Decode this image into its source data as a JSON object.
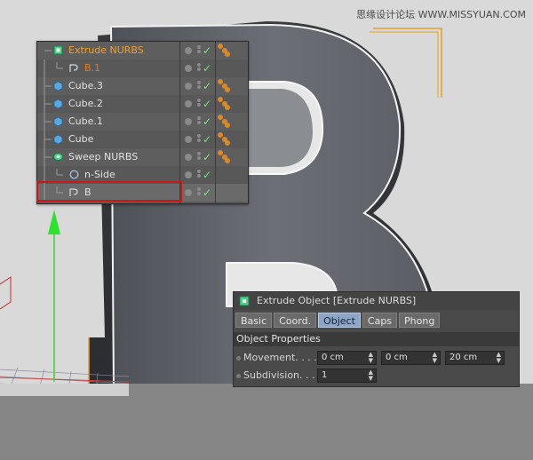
{
  "watermark": "思缘设计论坛 WWW.MISSYUAN.COM",
  "object_manager": {
    "items": [
      {
        "label": "Extrude NURBS",
        "color": "#f0a030",
        "indent": 0,
        "icon": "extrude-nurbs-icon"
      },
      {
        "label": "B.1",
        "color": "#e07e2c",
        "indent": 1,
        "icon": "spline-icon"
      },
      {
        "label": "Cube.3",
        "color": "#e2e2e2",
        "indent": 0,
        "icon": "cube-icon"
      },
      {
        "label": "Cube.2",
        "color": "#e2e2e2",
        "indent": 0,
        "icon": "cube-icon"
      },
      {
        "label": "Cube.1",
        "color": "#e2e2e2",
        "indent": 0,
        "icon": "cube-icon"
      },
      {
        "label": "Cube",
        "color": "#e2e2e2",
        "indent": 0,
        "icon": "cube-icon"
      },
      {
        "label": "Sweep NURBS",
        "color": "#e2e2e2",
        "indent": 0,
        "icon": "sweep-nurbs-icon"
      },
      {
        "label": "n-Side",
        "color": "#e2e2e2",
        "indent": 1,
        "icon": "circle-spline-icon"
      },
      {
        "label": "B",
        "color": "#e2e2e2",
        "indent": 1,
        "icon": "spline-icon"
      }
    ]
  },
  "attributes": {
    "title": "Extrude Object [Extrude NURBS]",
    "tabs": [
      "Basic",
      "Coord.",
      "Object",
      "Caps",
      "Phong"
    ],
    "active_tab": "Object",
    "section": "Object Properties",
    "movement": {
      "label": "Movement. . . .",
      "x": "0 cm",
      "y": "0 cm",
      "z": "20 cm"
    },
    "subdivision": {
      "label": "Subdivision. . .",
      "value": "1"
    }
  },
  "colors": {
    "accent": "#8da6c6",
    "selection_outline": "#c81818",
    "check": "#7ee07e"
  }
}
